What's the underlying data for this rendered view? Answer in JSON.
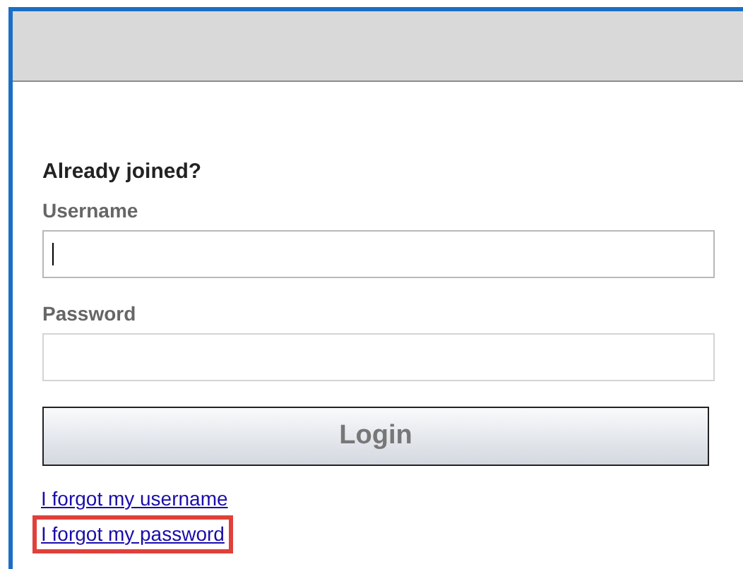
{
  "heading": "Already joined?",
  "fields": [
    {
      "label": "Username",
      "focused": true
    },
    {
      "label": "Password",
      "focused": false
    }
  ],
  "login_button": {
    "label": "Login"
  },
  "links": [
    {
      "label": "I forgot my username",
      "highlighted": false
    },
    {
      "label": "I forgot my password",
      "highlighted": true
    }
  ]
}
